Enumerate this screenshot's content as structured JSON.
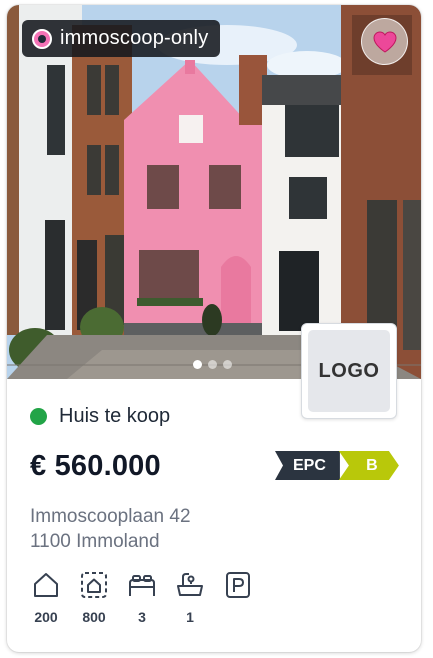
{
  "listing": {
    "badge_label": "immoscoop-only",
    "photo": {
      "total_photos": 3,
      "active_index": 0
    },
    "logo_placeholder": "LOGO",
    "status_label": "Huis te koop",
    "price": "€ 560.000",
    "epc": {
      "label": "EPC",
      "value": "B"
    },
    "address_line1": "Immoscooplaan 42",
    "address_line2": "1100 Immoland",
    "features": [
      {
        "icon": "house-icon",
        "value": "200"
      },
      {
        "icon": "plot-icon",
        "value": "800"
      },
      {
        "icon": "bed-icon",
        "value": "3"
      },
      {
        "icon": "bath-icon",
        "value": "1"
      },
      {
        "icon": "parking-icon",
        "value": ""
      }
    ]
  },
  "colors": {
    "status_green": "#22a447",
    "favorite_pink": "#ec4899",
    "epc_dark": "#2b3440",
    "epc_b": "#b9c80a",
    "house_pink": "#f08fb0"
  }
}
